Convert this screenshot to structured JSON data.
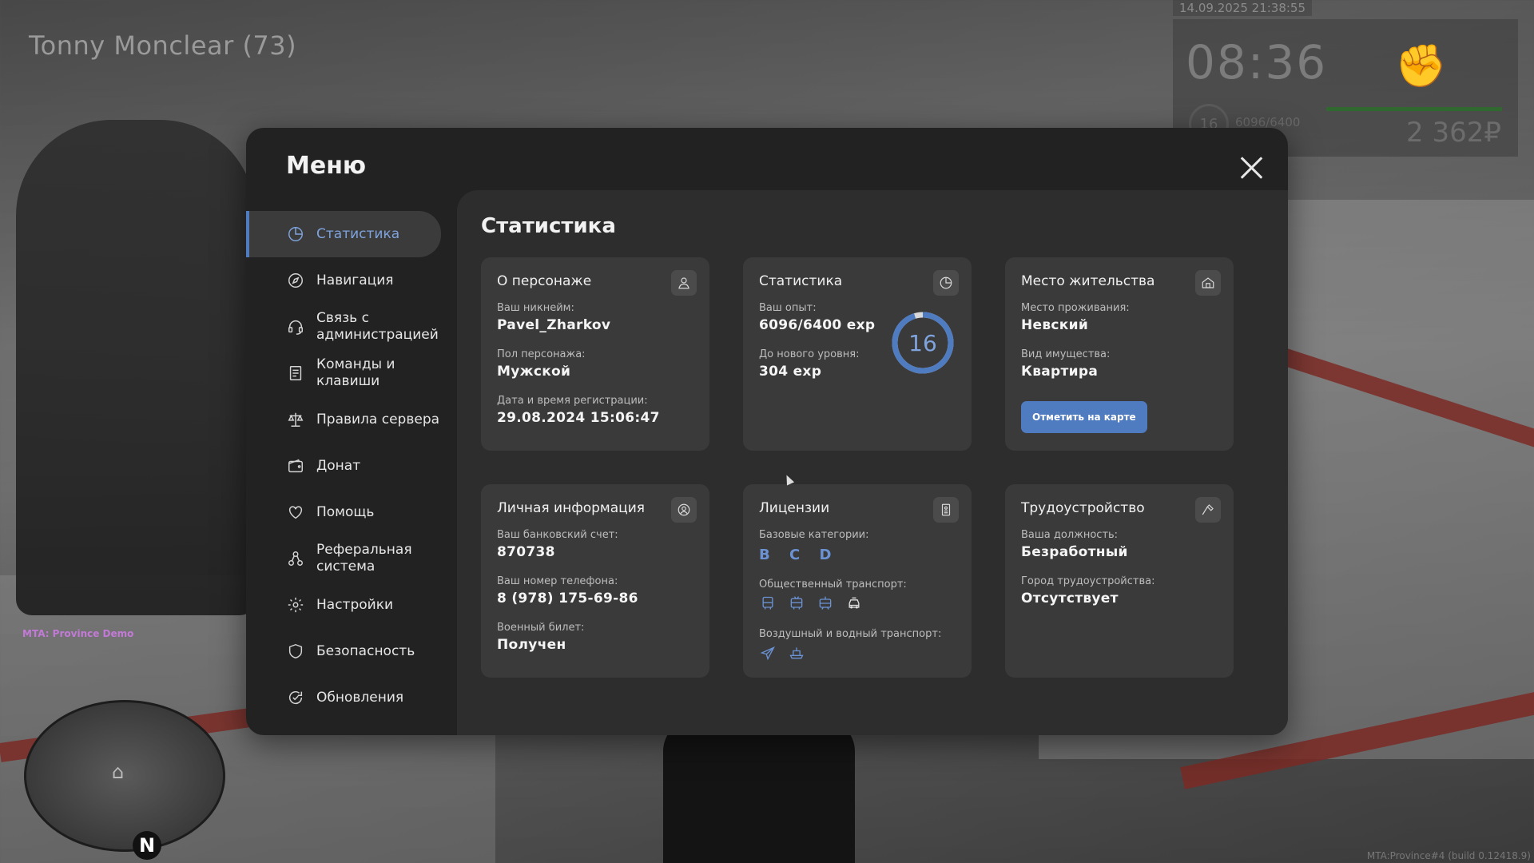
{
  "hud": {
    "player_name": "Tonny Monclear (73)",
    "datetime": "14.09.2025 21:38:55",
    "time": "08:36",
    "level": "16",
    "exp": "6096/6400",
    "money": "2 362₽",
    "server_name": "MTA: Province Demo",
    "build": "MTA:Province#4 (build 0.12418.9)"
  },
  "menu": {
    "title": "Меню",
    "items": [
      {
        "label": "Статистика",
        "icon": "chart-pie-icon",
        "active": true
      },
      {
        "label": "Навигация",
        "icon": "compass-icon"
      },
      {
        "label": "Связь с\nадминистрацией",
        "icon": "headset-icon"
      },
      {
        "label": "Команды и\nклавиши",
        "icon": "document-list-icon"
      },
      {
        "label": "Правила сервера",
        "icon": "scales-icon"
      },
      {
        "label": "Донат",
        "icon": "wallet-icon"
      },
      {
        "label": "Помощь",
        "icon": "heart-hand-icon"
      },
      {
        "label": "Реферальная\nсистема",
        "icon": "people-network-icon"
      },
      {
        "label": "Настройки",
        "icon": "gear-icon"
      },
      {
        "label": "Безопасность",
        "icon": "shield-icon"
      },
      {
        "label": "Обновления",
        "icon": "refresh-check-icon"
      }
    ]
  },
  "stats": {
    "title": "Статистика",
    "character": {
      "title": "О персонаже",
      "nickname_label": "Ваш никнейм:",
      "nickname": "Pavel_Zharkov",
      "gender_label": "Пол персонажа:",
      "gender": "Мужской",
      "reg_label": "Дата и время регистрации:",
      "reg_date": "29.08.2024 15:06:47"
    },
    "statistics": {
      "title": "Статистика",
      "exp_label": "Ваш опыт:",
      "exp": "6096/6400 exp",
      "next_label": "До нового уровня:",
      "next": "304 exp",
      "level": "16",
      "progress": 0.9525
    },
    "residence": {
      "title": "Место жительства",
      "place_label": "Место проживания:",
      "place": "Невский",
      "property_label": "Вид имущества:",
      "property": "Квартира",
      "button": "Отметить на карте"
    },
    "personal": {
      "title": "Личная информация",
      "bank_label": "Ваш банковский счет:",
      "bank": "870738",
      "phone_label": "Ваш номер телефона:",
      "phone": "8 (978) 175-69-86",
      "military_label": "Военный билет:",
      "military": "Получен"
    },
    "licenses": {
      "title": "Лицензии",
      "base_label": "Базовые категории:",
      "categories": "B C D",
      "public_label": "Общественный транспорт:",
      "air_label": "Воздушный и водный транспорт:"
    },
    "job": {
      "title": "Трудоустройство",
      "position_label": "Ваша должность:",
      "position": "Безработный",
      "city_label": "Город трудоустройства:",
      "city": "Отсутствует"
    }
  },
  "colors": {
    "accent": "#4f7bc0",
    "accent_text": "#7fa3dc",
    "license_blue": "#6b92d3"
  }
}
